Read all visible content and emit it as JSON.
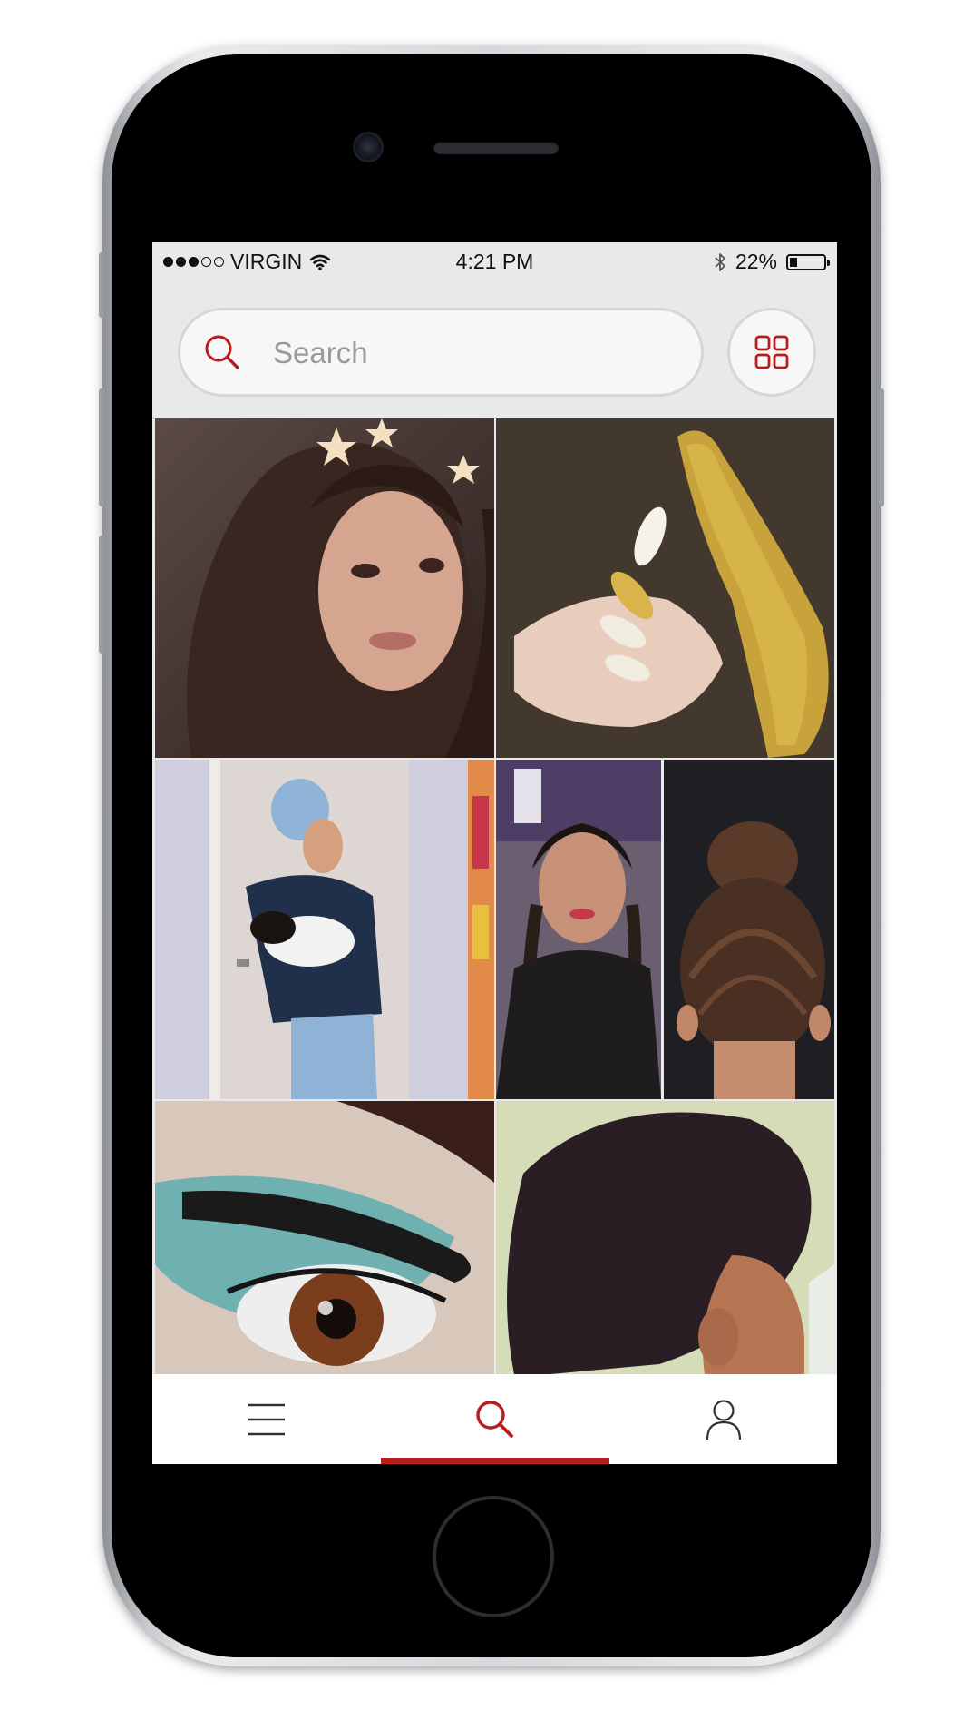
{
  "status_bar": {
    "carrier": "VIRGIN",
    "time": "4:21 PM",
    "battery_percent": "22%",
    "battery_level": 0.22,
    "signal_bars_filled": 3,
    "signal_bars_total": 5
  },
  "search": {
    "placeholder": "Search",
    "value": ""
  },
  "colors": {
    "accent": "#b81d1d",
    "screen_background": "#e9e9e9"
  },
  "icons": {
    "search": "search-icon",
    "grid": "grid-icon",
    "menu": "menu-icon",
    "profile": "profile-icon"
  },
  "tabs": [
    {
      "icon": "menu-icon",
      "active": false
    },
    {
      "icon": "search-icon",
      "active": true
    },
    {
      "icon": "profile-icon",
      "active": false
    }
  ]
}
